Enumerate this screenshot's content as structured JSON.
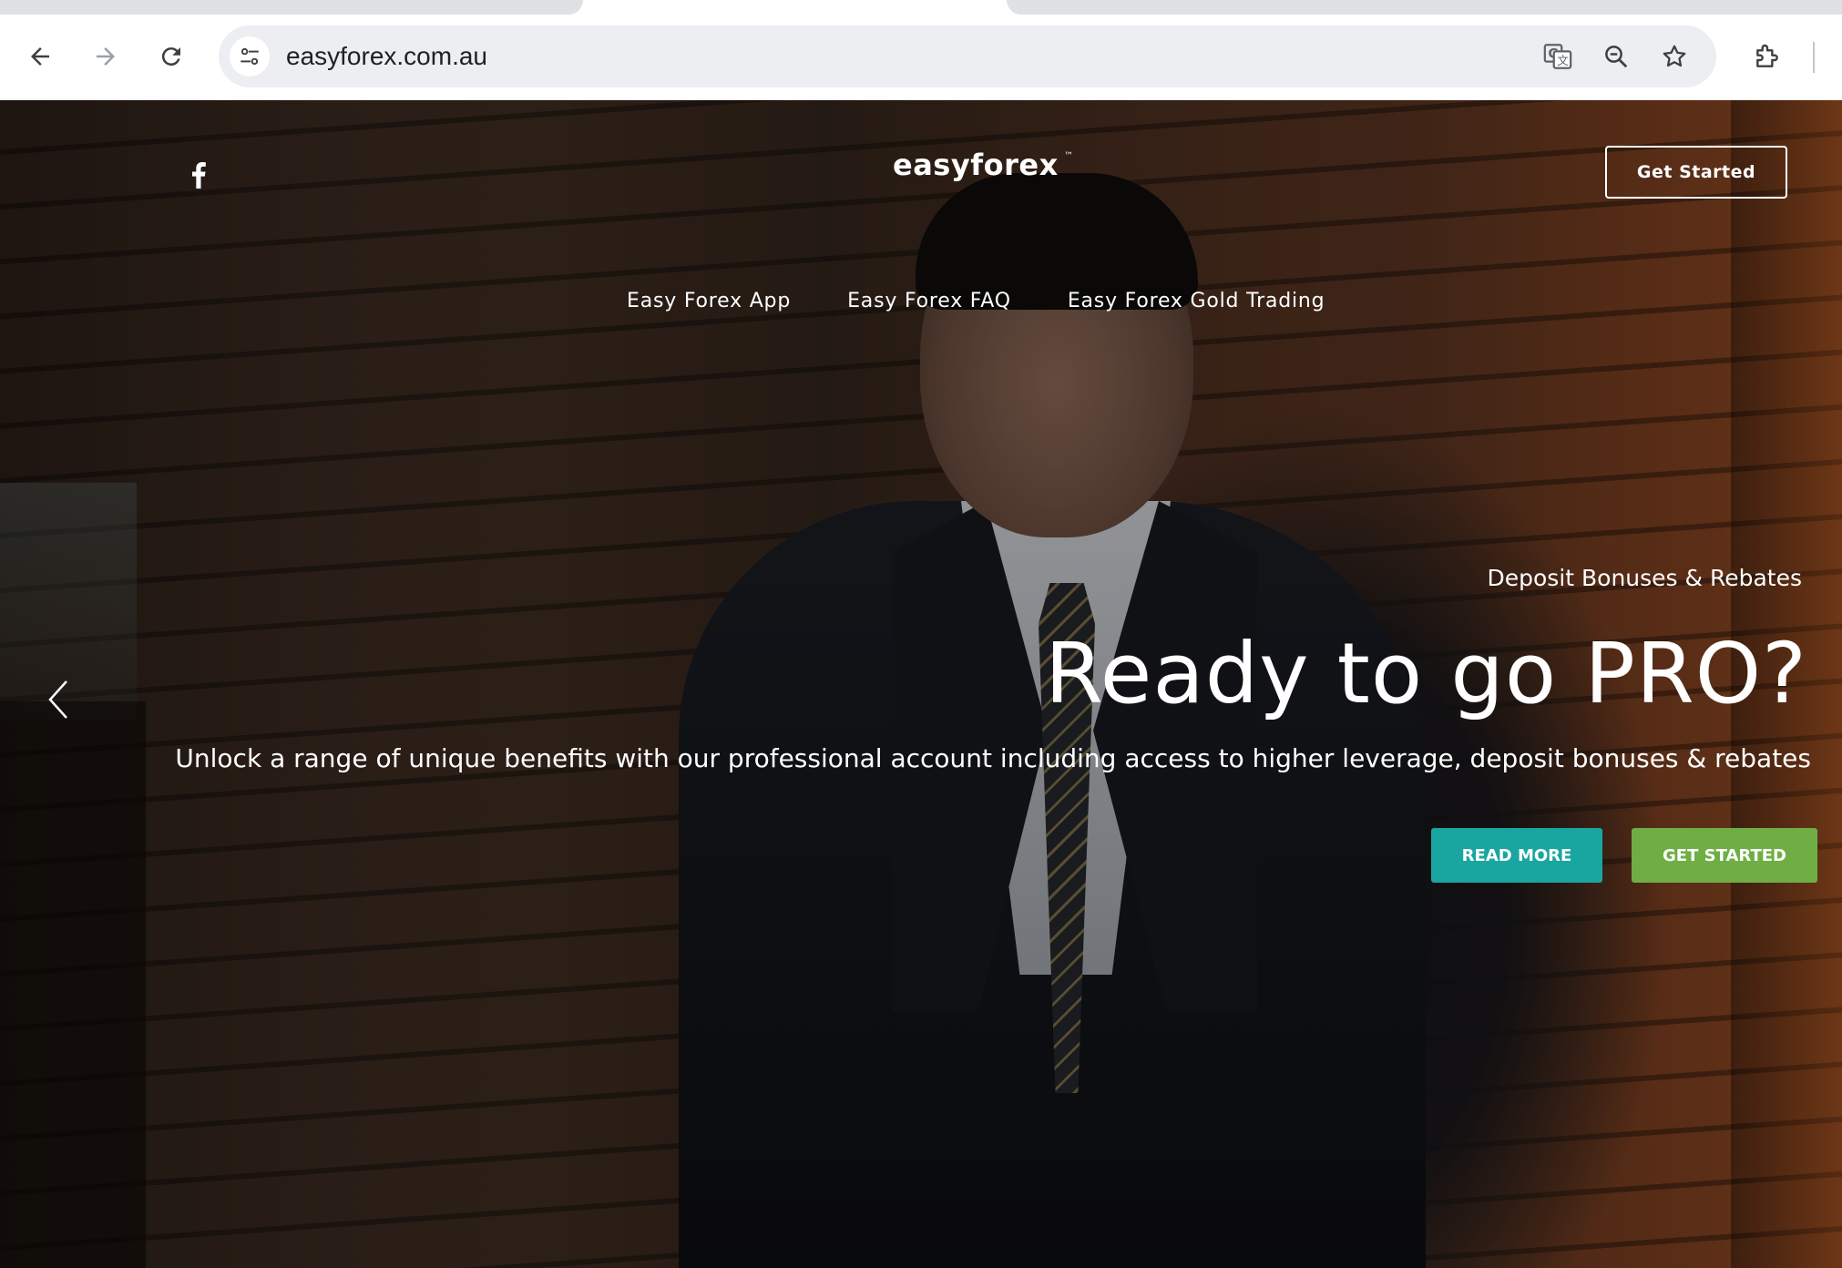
{
  "browser": {
    "url": "easyforex.com.au",
    "icons": {
      "back": "back-arrow-icon",
      "forward": "forward-arrow-icon",
      "reload": "reload-icon",
      "site_info": "tune-icon",
      "translate": "translate-icon",
      "zoom": "zoom-out-icon",
      "bookmark": "star-icon",
      "extensions": "puzzle-icon"
    }
  },
  "site": {
    "logo": "easyforex",
    "logo_tm": "™",
    "header_cta": "Get Started",
    "social_icon": "facebook-icon",
    "nav": [
      {
        "label": "Easy Forex App"
      },
      {
        "label": "Easy Forex FAQ"
      },
      {
        "label": "Easy Forex Gold Trading"
      }
    ]
  },
  "slide": {
    "eyebrow": "Deposit Bonuses & Rebates",
    "title": "Ready to go PRO?",
    "body": "Unlock a range of unique benefits with our professional account including access to higher leverage, deposit bonuses & rebates",
    "buttons": {
      "read_more": "READ MORE",
      "get_started": "GET STARTED"
    },
    "prev_icon": "chevron-left-icon"
  },
  "colors": {
    "read_more": "#1aa6a0",
    "get_started": "#6fae45",
    "omnibox": "#eceef1"
  }
}
